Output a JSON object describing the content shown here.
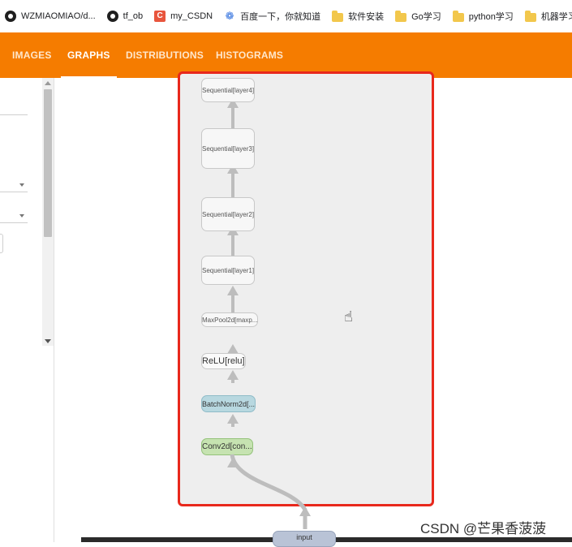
{
  "bookmarks": [
    {
      "label": "WZMIAOMIAO/d...",
      "icon": "github-icon"
    },
    {
      "label": "tf_ob",
      "icon": "github-icon"
    },
    {
      "label": "my_CSDN",
      "icon": "csdn-icon"
    },
    {
      "label": "百度一下，你就知道",
      "icon": "baidu-paw-icon"
    },
    {
      "label": "软件安装",
      "icon": "folder-icon"
    },
    {
      "label": "Go学习",
      "icon": "folder-icon"
    },
    {
      "label": "python学习",
      "icon": "folder-icon"
    },
    {
      "label": "机器学习",
      "icon": "folder-icon"
    }
  ],
  "header": {
    "color": "#f57c00",
    "tabs": [
      {
        "label": "IMAGES",
        "active": false
      },
      {
        "label": "GRAPHS",
        "active": true
      },
      {
        "label": "DISTRIBUTIONS",
        "active": false
      },
      {
        "label": "HISTOGRAMS",
        "active": false
      }
    ]
  },
  "graph": {
    "highlight_color": "#e8281c",
    "nodes": [
      {
        "label": "Sequential[layer4]"
      },
      {
        "label": "Sequential[layer3]"
      },
      {
        "label": "Sequential[layer2]"
      },
      {
        "label": "Sequential[layer1]"
      },
      {
        "label": "MaxPool2d[maxp..."
      },
      {
        "label": "ReLU[relu]"
      },
      {
        "label": "BatchNorm2d[..."
      },
      {
        "label": "Conv2d[con..."
      }
    ],
    "input_label": "input"
  },
  "watermark": "CSDN @芒果香菠菠"
}
